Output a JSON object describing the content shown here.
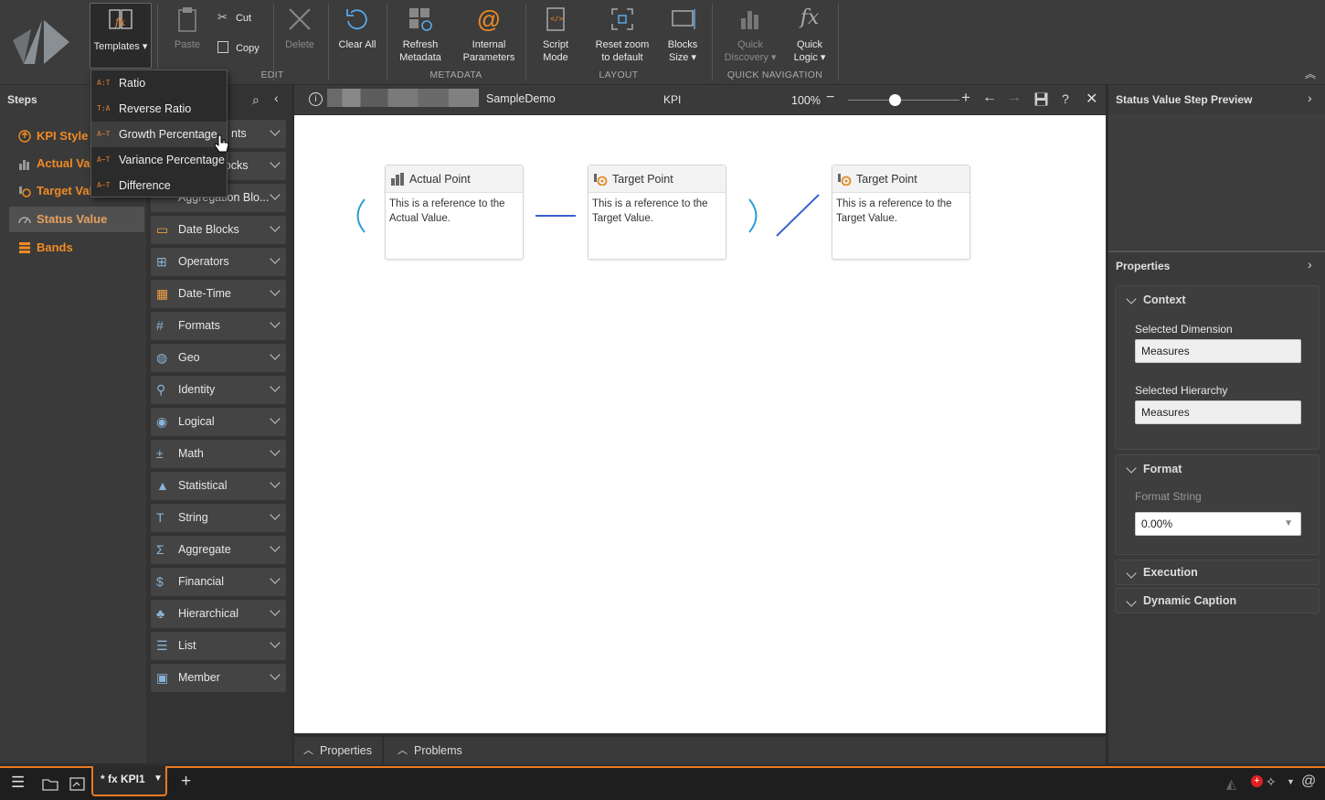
{
  "ribbon": {
    "templates_label": "Templates ▾",
    "paste_label": "Paste",
    "cut_label": "Cut",
    "copy_label": "Copy",
    "delete_label": "Delete",
    "clear_all_label": "Clear All",
    "edit_group": "EDIT",
    "refresh_metadata_label": "Refresh Metadata",
    "internal_parameters_label": "Internal Parameters",
    "metadata_group": "METADATA",
    "script_mode_label": "Script Mode",
    "reset_zoom_label": "Reset zoom to default",
    "blocks_size_label": "Blocks Size ▾",
    "layout_group": "LAYOUT",
    "quick_discovery_label": "Quick Discovery ▾",
    "quick_logic_label": "Quick Logic ▾",
    "quick_nav_group": "QUICK NAVIGATION"
  },
  "templates_menu": {
    "items": [
      {
        "abbr": "A:T",
        "label": "Ratio"
      },
      {
        "abbr": "T:A",
        "label": "Reverse Ratio"
      },
      {
        "abbr": "A−T",
        "label": "Growth Percentage"
      },
      {
        "abbr": "A−T",
        "label": "Variance Percentage"
      },
      {
        "abbr": "A−T",
        "label": "Difference"
      }
    ]
  },
  "steps": {
    "title": "Steps",
    "items": [
      {
        "label": "KPI Style"
      },
      {
        "label": "Actual Val"
      },
      {
        "label": "Target Val"
      },
      {
        "label": "Status Value"
      },
      {
        "label": "Bands"
      }
    ]
  },
  "library": {
    "partial": [
      "nts",
      "locks",
      "Aggregation Blo..."
    ],
    "categories": [
      "Date Blocks",
      "Operators",
      "Date-Time",
      "Formats",
      "Geo",
      "Identity",
      "Logical",
      "Math",
      "Statistical",
      "String",
      "Aggregate",
      "Financial",
      "Hierarchical",
      "List",
      "Member"
    ]
  },
  "canvas_bar": {
    "model_name": "SampleDemo",
    "mode": "KPI",
    "zoom": "100%",
    "help": "?"
  },
  "nodes": [
    {
      "title": "Actual Point",
      "body": "This is a reference to the Actual Value."
    },
    {
      "title": "Target Point",
      "body": "This is a reference to the Target Value."
    },
    {
      "title": "Target Point",
      "body": "This is a reference to the Target Value."
    }
  ],
  "bottom_tabs": {
    "properties": "Properties",
    "problems": "Problems"
  },
  "right": {
    "preview_title": "Status Value Step Preview",
    "properties_title": "Properties",
    "context_title": "Context",
    "selected_dimension_label": "Selected Dimension",
    "selected_dimension_value": "Measures",
    "selected_hierarchy_label": "Selected Hierarchy",
    "selected_hierarchy_value": "Measures",
    "format_title": "Format",
    "format_string_label": "Format String",
    "format_string_value": "0.00%",
    "execution_title": "Execution",
    "dynamic_caption_title": "Dynamic Caption"
  },
  "taskbar": {
    "tab_label": "* fx KPI1",
    "add": "+"
  },
  "colors": {
    "accent": "#f08a24",
    "link_blue": "#3a5fcf",
    "paren_blue": "#2a9fd8"
  }
}
